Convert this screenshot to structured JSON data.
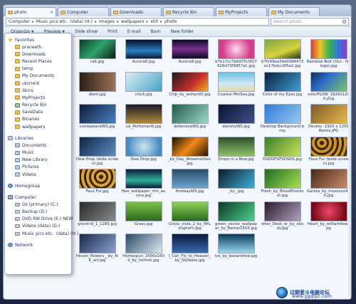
{
  "tabs": [
    {
      "label": "photo",
      "active": true
    },
    {
      "label": "Computer",
      "active": false
    },
    {
      "label": "Downloads",
      "active": false
    },
    {
      "label": "Recycle Bin",
      "active": false
    },
    {
      "label": "MyProjects",
      "active": false
    },
    {
      "label": "My Documents",
      "active": false
    }
  ],
  "address": {
    "crumbs": [
      "Computer",
      "Music pics etc.. (data) (H:)",
      "Images",
      "wallpapers",
      "still",
      "photo"
    ],
    "search_placeholder": "Search photo"
  },
  "toolbar": {
    "organize": "Organize",
    "preview": "Preview",
    "slideshow": "Slide show",
    "print": "Print",
    "email": "E-mail",
    "burn": "Burn",
    "new_folder": "New folder"
  },
  "nav": {
    "favorites_title": "Favorites",
    "favorites": [
      "praneeth",
      "Downloads",
      "Recent Places",
      "temp",
      "My Documents",
      "utorrent",
      "Skins",
      "MyProjects",
      "Recycle Bin",
      "SaveData",
      "Binaries",
      "wallpapers"
    ],
    "libraries_title": "Libraries",
    "libraries": [
      "Documents",
      "Music",
      "New Library",
      "Pictures",
      "Videos"
    ],
    "homegroup_title": "Homegroup",
    "computer_title": "Computer",
    "drives": [
      "Os (primary) (C:)",
      "Backup (D:)",
      "DVD RW Drive (E:) NEW",
      "Videos (data) (G:)",
      "Music pics etc.. (data) (H:)"
    ],
    "network_title": "Network"
  },
  "files": [
    {
      "name": "ra6.jpg"
    },
    {
      "name": "Aurora8.jpg"
    },
    {
      "name": "Aurora9.jpg"
    },
    {
      "name": "b7e17cc7b0d75c0f17626d73f5857af..jpg"
    },
    {
      "name": "b7fc49ea34e00d4473ec17bdcc3f5a2.jpg"
    },
    {
      "name": "Rainbow Bolt (Out - No logo).jpg"
    },
    {
      "name": "dient.jpg"
    },
    {
      "name": "chick.jpg"
    },
    {
      "name": "Chip_by_wshan00.jpg"
    },
    {
      "name": "Coastal MinSea.jpg"
    },
    {
      "name": "Color of my Eyes.jpg"
    },
    {
      "name": "colorFLOW_1920x1200.png"
    },
    {
      "name": "comepeaceWS.jpg"
    },
    {
      "name": "ue_PerfumanN.jpg"
    },
    {
      "name": "defensiveWS.jpg"
    },
    {
      "name": "densityWS.jpg"
    },
    {
      "name": "Desktop Background.bmp"
    },
    {
      "name": "Deutec -1920 x 1200 Remix.JPG"
    },
    {
      "name": "Dew Drop (wide screen).jpg"
    },
    {
      "name": "Dew Drop.jpg"
    },
    {
      "name": "_by_Day_WreamerSev.jpg"
    },
    {
      "name": "Drops in a Row.jpg"
    },
    {
      "name": "DSDGFGFSDSDS.jpg"
    },
    {
      "name": "Faux Fur (wide screen).jpg"
    },
    {
      "name": "Faux Fur.jpg"
    },
    {
      "name": "files_wallpaper_rtm_aurora.jpg"
    },
    {
      "name": "findwayWS.jpg"
    },
    {
      "name": "_by_.jpg"
    },
    {
      "name": "Fresh_by_BloodPromiser.jpg"
    },
    {
      "name": "Garota_by_mazzuco470.jpg"
    },
    {
      "name": "ghostrid_1_1280.jpg"
    },
    {
      "name": "Grass.jpg"
    },
    {
      "name": "Grass_vista_2_by_MrLonghorn.jpg"
    },
    {
      "name": "green_vector_wallpaper_by_Bartas1503.jpg"
    },
    {
      "name": "otter_Desk_er_by_xbody.jpg"
    },
    {
      "name": "Heart_by_williamliew.jpg"
    },
    {
      "name": "Heven_flowers__by_AiK_art.jpg"
    },
    {
      "name": "Homespun_2560x1600_by_hermik.jpg"
    },
    {
      "name": "I_Can_Fly_to_Heaven_by_Skybase.jpg"
    },
    {
      "name": "Ice_by_beeandrew.jpg"
    },
    {
      "name": ""
    }
  ],
  "colors": {
    "thumbs": [
      "linear-gradient(135deg,#0b3d2a,#2fa36b 50%,#0c1f14)",
      "linear-gradient(180deg,#05102a,#2b7fbf 60%,#0e1a3a)",
      "linear-gradient(180deg,#0a0d25,#7b2f8f 50%,#0f0a20)",
      "radial-gradient(circle,#ffd9ef,#d43f8c 70%)",
      "linear-gradient(160deg,#7ba34a,#d8d23b 60%,#1c3a12)",
      "linear-gradient(90deg,#e23a3a,#f0c52b,#3bb34a,#2f7ad8,#8a3ac9)",
      "linear-gradient(90deg,#2a1f14,#a0715a)",
      "linear-gradient(135deg,#d9eef7,#4aa0c6)",
      "linear-gradient(135deg,#1b1b1b,#c72e2e 60%,#f0b11a)",
      "linear-gradient(180deg,#6cc1e8,#cfe9f5 60%,#e3d7a8)",
      "linear-gradient(135deg,#0a1e3d,#3fa0d8)",
      "linear-gradient(135deg,#0e2f5a,#2d6fc9 40%,#7ec46b)",
      "linear-gradient(135deg,#0d1d3a,#4a7fc0)",
      "linear-gradient(180deg,#1a1a2a,#b08b3a)",
      "linear-gradient(135deg,#1e5a4a,#9fd8c7)",
      "linear-gradient(135deg,#0b1530,#3e4f8a)",
      "linear-gradient(135deg,#2d7ad6,#98c8f0)",
      "linear-gradient(135deg,#7d5a2a,#e8b84a)",
      "linear-gradient(135deg,#0f2340,#5c8ec6)",
      "radial-gradient(circle,#cde6f4,#4a8cc0 80%)",
      "linear-gradient(135deg,#1a0f05,#f08a1a 50%,#2a1405)",
      "linear-gradient(180deg,#2e4f2a,#8fc06a)",
      "linear-gradient(135deg,#3a7f2a,#c8e05a)",
      "repeating-radial-gradient(circle at 30% 30%,#3a2205 0 3px,#c8952e 3px 7px)",
      "repeating-radial-gradient(circle at 60% 40%,#3a2205 0 3px,#d8a23e 3px 7px)",
      "linear-gradient(180deg,#0c1a3a,#2fb39a 60%,#0c1a3a)",
      "linear-gradient(180deg,#2a4a6a,#6aa8d0)",
      "linear-gradient(135deg,#0c1a2a,#3fb0d8)",
      "linear-gradient(135deg,#1e6a2a,#a8e04a)",
      "linear-gradient(135deg,#4a2a1a,#c88a6a)",
      "linear-gradient(135deg,#2a2a2a,#8a8a8a)",
      "linear-gradient(180deg,#7ac14a,#2e6a1a)",
      "linear-gradient(180deg,#8fd05a,#2a6a1a)",
      "linear-gradient(135deg,#0e3a2a,#4ad08a)",
      "linear-gradient(135deg,#2a1a2a,#b0a0c0)",
      "radial-gradient(circle,#f04a6a,#7a0a1a 80%)",
      "linear-gradient(135deg,#1a2a4a,#8aa0d0)",
      "linear-gradient(135deg,#2a4a6a,#e0e8f0)",
      "linear-gradient(180deg,#0a1a3a,#3a6ab0)",
      "linear-gradient(180deg,#0a3a5a,#9ad8f0)",
      "linear-gradient(135deg,#f3f6fb,#f3f6fb)"
    ]
  },
  "watermark": {
    "text": "过期爱斗电脑论坛",
    "url": "www.ggqtpc.com"
  }
}
